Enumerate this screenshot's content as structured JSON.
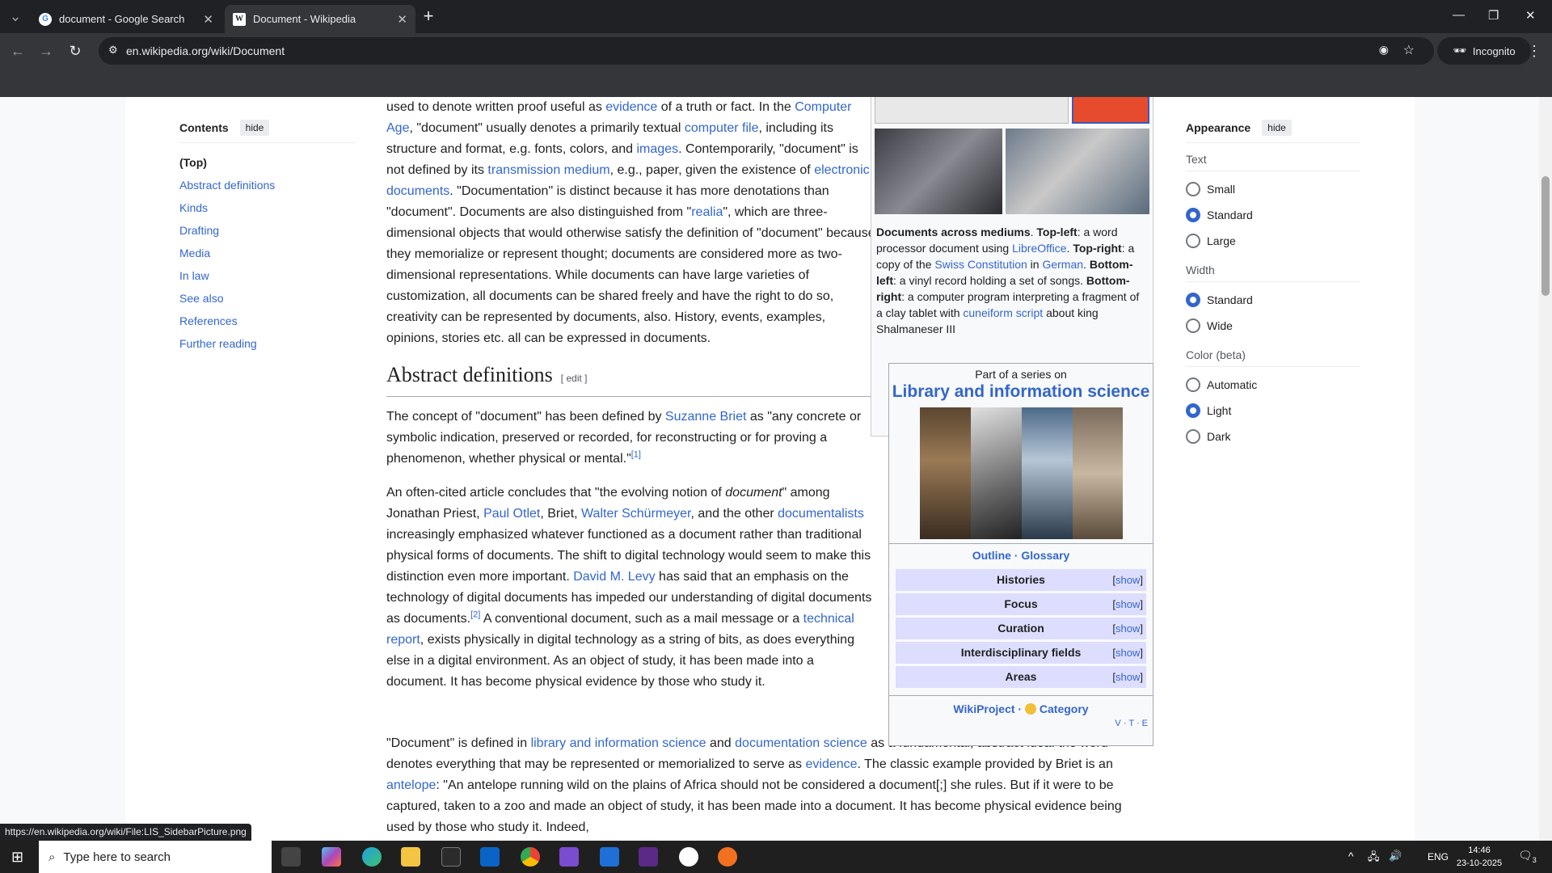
{
  "browser": {
    "tabs": [
      {
        "title": "document - Google Search",
        "active": false
      },
      {
        "title": "Document - Wikipedia",
        "active": true
      }
    ],
    "url": "en.wikipedia.org/wiki/Document",
    "incognito_label": "Incognito",
    "status_url": "https://en.wikipedia.org/wiki/File:LIS_SidebarPicture.png"
  },
  "toc": {
    "title": "Contents",
    "hide": "hide",
    "items": [
      "(Top)",
      "Abstract definitions",
      "Kinds",
      "Drafting",
      "Media",
      "In law",
      "See also",
      "References",
      "Further reading"
    ]
  },
  "article": {
    "p1": [
      "used to denote written proof useful as ",
      {
        "link": "evidence"
      },
      " of a truth or fact. In the ",
      {
        "link": "Computer Age"
      },
      ", \"document\" usually denotes a primarily textual ",
      {
        "link": "computer file"
      },
      ", including its structure and format, e.g. fonts, colors, and ",
      {
        "link": "images"
      },
      ". Contemporarily, \"document\" is not defined by its ",
      {
        "link": "transmission medium"
      },
      ", e.g., paper, given the existence of ",
      {
        "link": "electronic documents"
      },
      ". \"Documentation\" is distinct because it has more denotations than \"document\". Documents are also distinguished from \"",
      {
        "link": "realia"
      },
      "\", which are three-dimensional objects that would otherwise satisfy the definition of \"document\" because they memorialize or represent thought; documents are considered more as two-dimensional representations. While documents can have large varieties of customization, all documents can be shared freely and have the right to do so, creativity can be represented by documents, also. History, events, examples, opinions, stories etc. all can be expressed in documents."
    ],
    "h2": "Abstract definitions",
    "edit": "[ edit ]",
    "p2": [
      "The concept of \"document\" has been defined by ",
      {
        "link": "Suzanne Briet"
      },
      " as \"any concrete or symbolic indication, preserved or recorded, for reconstructing or for proving a phenomenon, whether physical or mental.\"",
      {
        "sup": "[1]"
      }
    ],
    "p3": [
      "An often-cited article concludes that \"the evolving notion of ",
      {
        "em": "document"
      },
      "\" among Jonathan Priest, ",
      {
        "link": "Paul Otlet"
      },
      ", Briet, ",
      {
        "link": "Walter Schürmeyer"
      },
      ", and the other ",
      {
        "link": "documentalists"
      },
      " increasingly emphasized whatever functioned as a document rather than traditional physical forms of documents. The shift to digital technology would seem to make this distinction even more important. ",
      {
        "link": "David M. Levy"
      },
      " has said that an emphasis on the technology of digital documents has impeded our understanding of digital documents as documents.",
      {
        "sup": "[2]"
      },
      " A conventional document, such as a mail message or a ",
      {
        "link": "technical report"
      },
      ", exists physically in digital technology as a string of bits, as does everything else in a digital environment. As an object of study, it has been made into a document. It has become physical evidence by those who study it."
    ],
    "p4": [
      "\"Document\" is defined in ",
      {
        "link": "library and information science"
      },
      " and ",
      {
        "link": "documentation science"
      },
      " as a fundamental, abstract idea: the word denotes everything that may be represented or memorialized to serve as ",
      {
        "link": "evidence"
      },
      ". The classic example provided by Briet is an ",
      {
        "link": "antelope"
      },
      ": \"An antelope running wild on the plains of Africa should not be considered a document[;] she rules. But if it were to be captured, taken to a zoo and made an object of study, it has been made into a document. It has become physical evidence being used by those who study it. Indeed,"
    ]
  },
  "caption": [
    {
      "b": "Documents across mediums"
    },
    ". ",
    {
      "b": "Top-left"
    },
    ": a word processor document using ",
    {
      "link": "LibreOffice"
    },
    ". ",
    {
      "b": "Top-right"
    },
    ": a copy of the ",
    {
      "link": "Swiss Constitution"
    },
    " in ",
    {
      "link": "German"
    },
    ". ",
    {
      "b": "Bottom-left"
    },
    ": a vinyl record holding a set of songs. ",
    {
      "b": "Bottom-right"
    },
    ": a computer program interpreting a fragment of a clay tablet with ",
    {
      "link": "cuneiform script"
    },
    " about king Shalmaneser III"
  ],
  "sidebox": {
    "part_of": "Part of a series on",
    "title": "Library and information science",
    "outline": "Outline",
    "glossary": "Glossary",
    "rows": [
      "Histories",
      "Focus",
      "Curation",
      "Interdisciplinary fields",
      "Areas"
    ],
    "show": "show",
    "wikiproject": "WikiProject",
    "category": "Category",
    "v": "V",
    "t": "T",
    "e": "E"
  },
  "appearance": {
    "title": "Appearance",
    "hide": "hide",
    "groups": [
      {
        "label": "Text",
        "options": [
          "Small",
          "Standard",
          "Large"
        ],
        "selected": 1
      },
      {
        "label": "Width",
        "options": [
          "Standard",
          "Wide"
        ],
        "selected": 0
      },
      {
        "label": "Color (beta)",
        "options": [
          "Automatic",
          "Light",
          "Dark"
        ],
        "selected": 1
      }
    ]
  },
  "taskbar": {
    "search_placeholder": "Type here to search",
    "lang": "ENG",
    "time": "14:46",
    "date": "23-10-2025",
    "notifications": "3"
  },
  "colors": {
    "link": "#3366cc",
    "chrome_bg": "#35363a",
    "tab_bg": "#202124",
    "series_row": "#ddddff"
  }
}
